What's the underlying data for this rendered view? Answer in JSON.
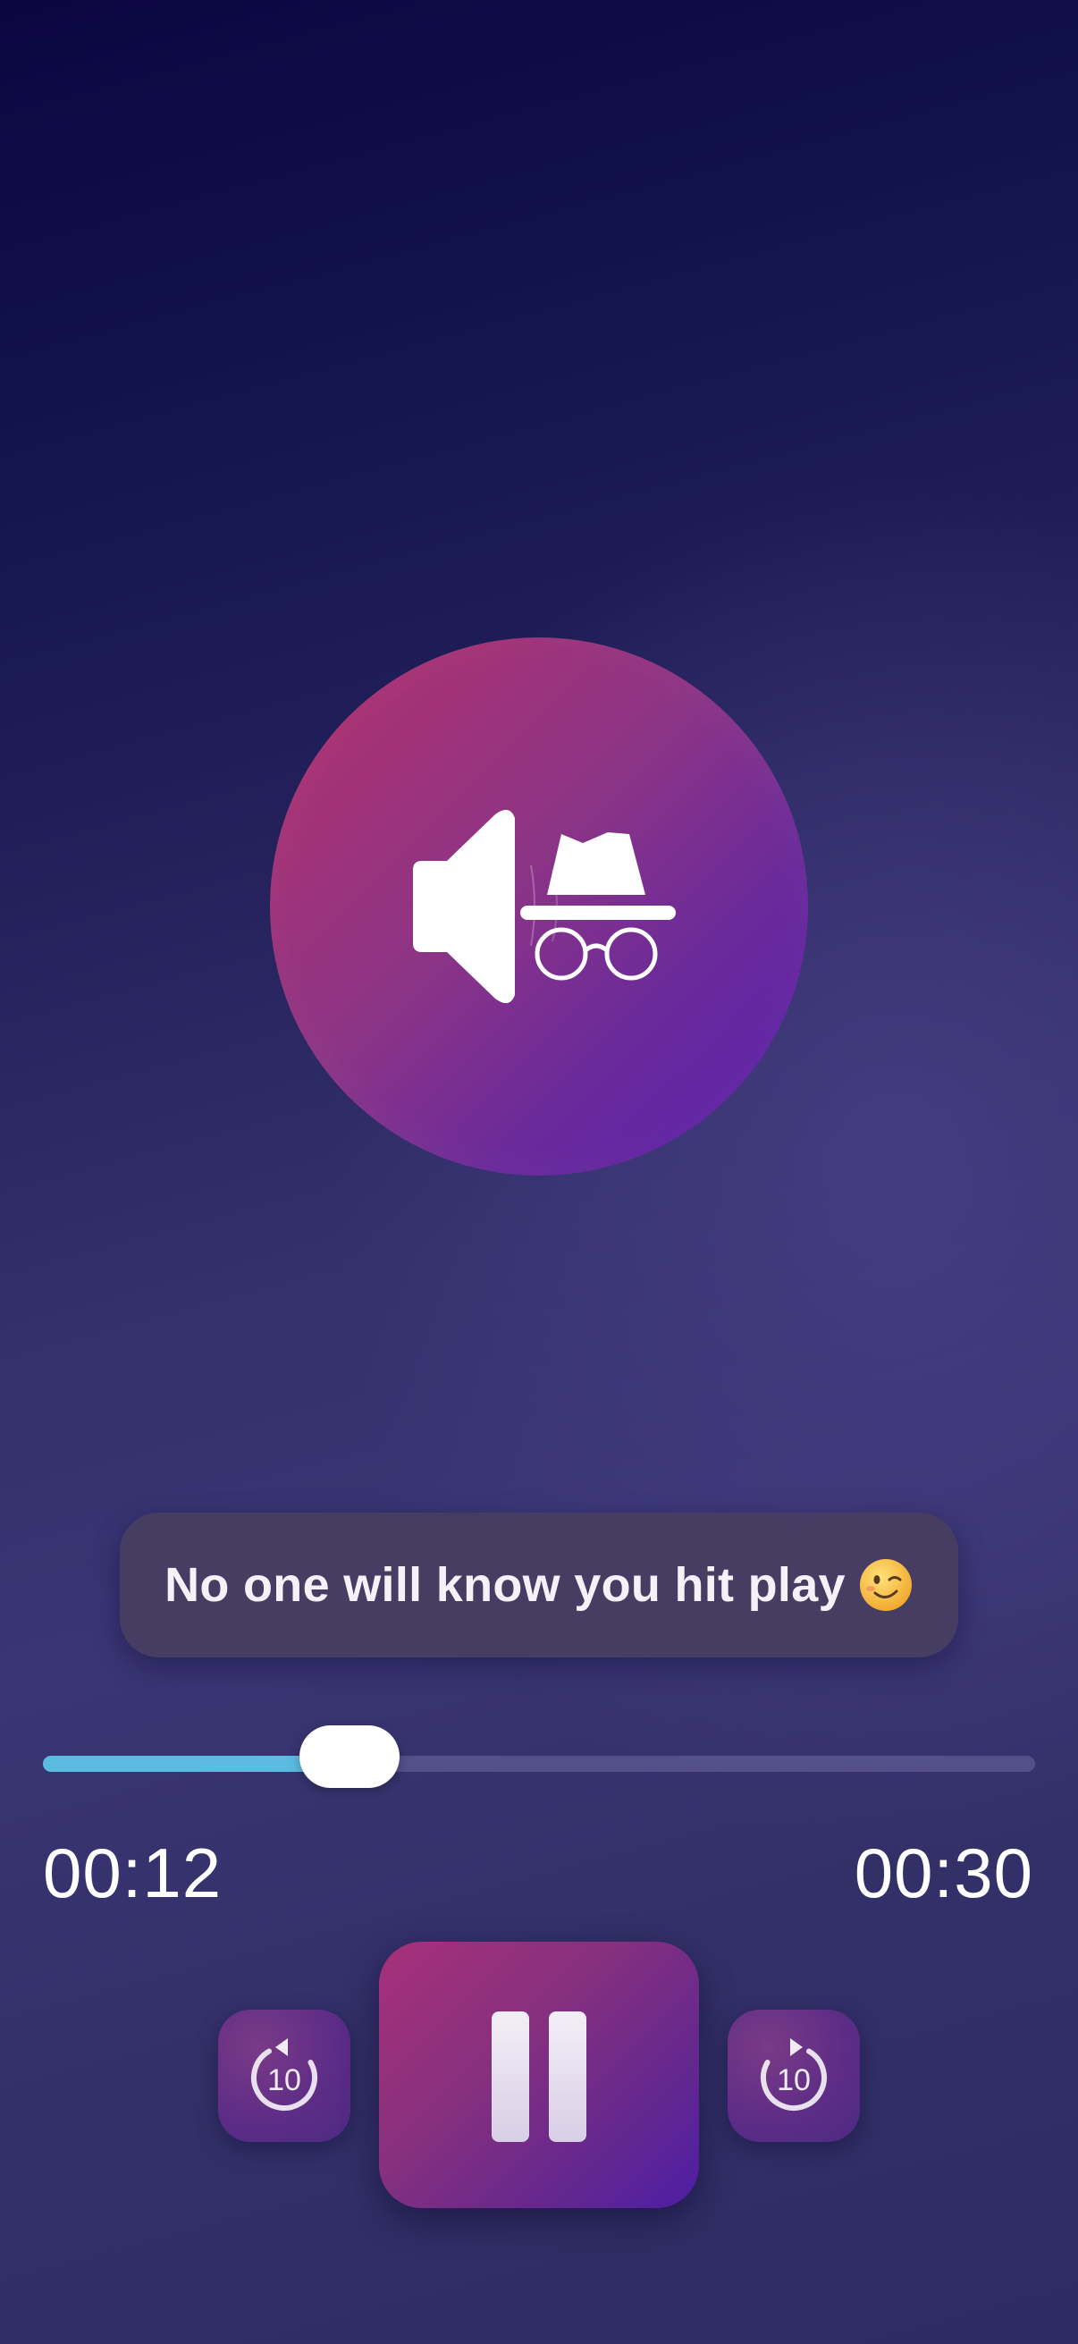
{
  "hero": {
    "icon": "incognito-speaker-icon"
  },
  "toast": {
    "text": "No one will know you hit play",
    "emoji": "winking-face-emoji"
  },
  "player": {
    "current_time": "00:12",
    "total_time": "00:30",
    "progress": 0.4,
    "accent_color": "#5bbbe0",
    "skip_back_seconds": "10",
    "skip_forward_seconds": "10",
    "state": "playing"
  }
}
